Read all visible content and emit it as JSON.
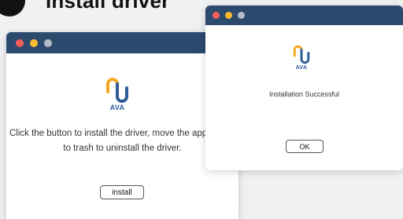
{
  "page": {
    "heading": "Install driver"
  },
  "colors": {
    "titlebar": "#2c4a6e",
    "dot_red": "#ff5f57",
    "dot_yellow": "#febc2e",
    "dot_gray": "#b6bcc6",
    "logo_orange": "#f5a623",
    "logo_blue": "#2f5c9a"
  },
  "installer_window": {
    "logo_text": "AVA",
    "instructions": "Click the button to install the driver, move the application to trash to uninstall the driver.",
    "install_button": "install"
  },
  "success_dialog": {
    "logo_text": "AVA",
    "status": "Installation Successful",
    "ok_button": "OK"
  }
}
